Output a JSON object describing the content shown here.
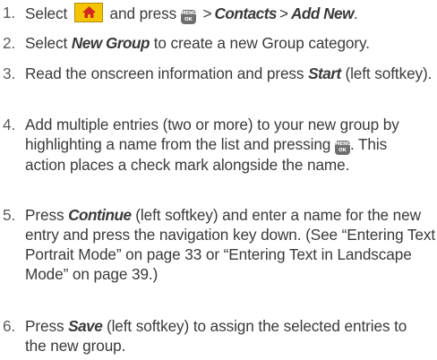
{
  "steps": [
    {
      "num": "1.",
      "t1": "Select",
      "icon1": "home-icon",
      "t2": "and press",
      "icon2": "menu-ok-key-icon",
      "key_line1": "MENU",
      "key_line2": "OK",
      "gt": ">",
      "path1": "Contacts",
      "path2": "Add New",
      "end": "."
    },
    {
      "num": "2.",
      "t1": "Select",
      "ui": "New Group",
      "t2": "to create a new Group category."
    },
    {
      "num": "3.",
      "t1": "Read the onscreen information and press",
      "ui": "Start",
      "t2": "(left softkey)."
    },
    {
      "num": "4.",
      "t1": "Add multiple entries (two or more) to your new group by highlighting a name from the list and pressing",
      "icon": "menu-ok-key-icon",
      "key_line1": "MENU",
      "key_line2": "OK",
      "t2": ". This action places a check mark alongside the name."
    },
    {
      "num": "5.",
      "t1": "Press",
      "ui": "Continue",
      "t2": "(left softkey) and enter a name for the new entry and press the navigation key down. (See “Entering Text in Portrait Mode” on page 33 or “Entering Text in Landscape Mode” on page 39.)"
    },
    {
      "num": "6.",
      "t1": "Press",
      "ui": "Save",
      "t2": "(left softkey) to assign the selected entries to the new group."
    }
  ],
  "colors": {
    "text": "#3a3a3a",
    "home_key_bg": "#f4c400",
    "home_icon": "#d2281e",
    "menu_key_bg": "#6f6f6f"
  }
}
